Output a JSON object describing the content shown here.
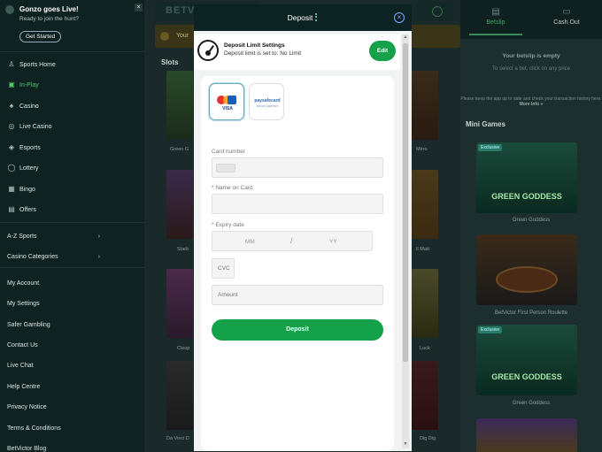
{
  "promo": {
    "title": "Gonzo goes Live!",
    "subtitle": "Ready to join the hunt?",
    "cta": "Get Started"
  },
  "nav": {
    "sports_home": "Sports Home",
    "in_play": "In-Play",
    "casino": "Casino",
    "live_casino": "Live Casino",
    "esports": "Esports",
    "lottery": "Lottery",
    "bingo": "Bingo",
    "offers": "Offers",
    "az_sports": "A-Z Sports",
    "casino_categories": "Casino Categories",
    "my_account": "My Account",
    "my_settings": "My Settings",
    "safer_gambling": "Safer Gambling",
    "contact_us": "Contact Us",
    "live_chat": "Live Chat",
    "help_centre": "Help Centre",
    "privacy_notice": "Privacy Notice",
    "terms": "Terms & Conditions",
    "blog": "BetVictor Blog"
  },
  "background": {
    "brand": "BETV",
    "your_bar": "Your",
    "slots_title": "Slots",
    "tile_labels": [
      "Green G",
      "Starb",
      "Cleop",
      "Da Vinci D"
    ],
    "tile_labels_right": [
      "Mirro",
      "Il Matt",
      "Luck",
      "Dig Dig"
    ],
    "tile_tag": "Exclusive"
  },
  "betslip": {
    "tab_betslip": "Betslip",
    "tab_cashout": "Cash Out",
    "empty_title": "Your betslip is empty",
    "empty_sub": "To select a bet, click on any price",
    "note": "Please keep the app up to date and check your transaction history here.",
    "note_link": "More Info »"
  },
  "mini_games": {
    "title": "Mini Games",
    "tag": "Exclusive",
    "items": [
      {
        "label": "Green Goddess",
        "banner": "GREEN GODDESS"
      },
      {
        "label": "BetVictor First Person Roulette",
        "banner": ""
      },
      {
        "label": "Green Goddess",
        "banner": "GREEN GODDESS"
      }
    ]
  },
  "modal": {
    "title": "Deposit",
    "limit_title": "Deposit Limit Settings",
    "limit_text": "Deposit limit is set to: No Limit",
    "edit_label": "Edit",
    "methods": {
      "card": "VISA",
      "paysafe": "paysafecard",
      "paysafe_sub": "secure payment"
    },
    "card_number_label": "Card number",
    "name_label": "* Name on Card",
    "expiry_label": "* Expiry date",
    "expiry_mm": "MM",
    "expiry_sep": "/",
    "expiry_yy": "YY",
    "cvc_placeholder": "CVC",
    "amount_placeholder": "Amount",
    "deposit_label": "Deposit"
  },
  "colors": {
    "brand_green": "#14a14a",
    "modal_header": "#0d2323",
    "sidebar": "#0f2222"
  }
}
